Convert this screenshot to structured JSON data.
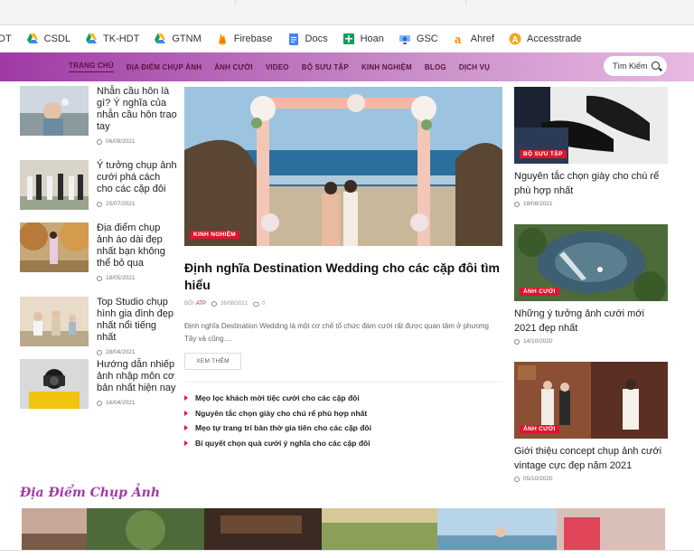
{
  "bookmarks": [
    {
      "label": "DT",
      "icon": "drive-icon"
    },
    {
      "label": "CSDL",
      "icon": "drive-icon"
    },
    {
      "label": "TK-HDT",
      "icon": "drive-icon"
    },
    {
      "label": "GTNM",
      "icon": "drive-icon"
    },
    {
      "label": "Firebase",
      "icon": "firebase-icon"
    },
    {
      "label": "Docs",
      "icon": "docs-icon"
    },
    {
      "label": "Hoan",
      "icon": "sheets-icon"
    },
    {
      "label": "GSC",
      "icon": "search-console-icon"
    },
    {
      "label": "Ahref",
      "icon": "ahrefs-icon"
    },
    {
      "label": "Accesstrade",
      "icon": "accesstrade-icon"
    }
  ],
  "nav": {
    "items": [
      "Trang chủ",
      "Địa điểm chụp ảnh",
      "Ảnh cưới",
      "Video",
      "Bộ sưu tập",
      "Kinh nghiệm",
      "Blog",
      "Dịch vụ"
    ],
    "search_placeholder": "Tìm Kiếm"
  },
  "left_posts": [
    {
      "title": "Nhẫn cầu hôn là gì? Ý nghĩa của nhẫn cầu hôn trao tay",
      "date": "06/08/2021"
    },
    {
      "title": "Ý tưởng chụp ảnh cưới phá cách cho các cặp đôi",
      "date": "25/07/2021"
    },
    {
      "title": "Địa điểm chụp ảnh áo dài đẹp nhất bạn không thể bỏ qua",
      "date": "18/05/2021"
    },
    {
      "title": "Top Studio chụp hình gia đình đẹp nhất nổi tiếng nhất",
      "date": "28/04/2021"
    },
    {
      "title": "Hướng dẫn nhiếp ảnh nhập môn cơ bản nhất hiện nay",
      "date": "16/04/2021"
    }
  ],
  "featured": {
    "badge": "Kinh nghiệm",
    "title": "Định nghĩa Destination Wedding cho các cặp đôi tìm hiểu",
    "by": "BỞI",
    "author": "ATP",
    "date": "26/08/2021",
    "comments": "0",
    "excerpt": "Định nghĩa Destination Wedding là một cơ chế tổ chức đám cưới rất được quan tâm ở phương Tây và cũng....",
    "more_label": "Xem thêm"
  },
  "related": [
    "Mẹo lọc khách mời tiệc cưới cho các cặp đôi",
    "Nguyên tắc chọn giày cho chú rể phù hợp nhất",
    "Mẹo tự trang trí bàn thờ gia tiên cho các cặp đôi",
    "Bí quyết chọn quà cưới ý nghĩa cho các cặp đôi"
  ],
  "right_posts": [
    {
      "badge": "Bộ sưu tập",
      "title": "Nguyên tắc chọn giày cho chú rể phù hợp nhất",
      "date": "18/08/2021"
    },
    {
      "badge": "Ảnh cưới",
      "title": "Những ý tưởng ảnh cưới mới 2021 đẹp nhất",
      "date": "14/10/2020"
    },
    {
      "badge": "Ảnh cưới",
      "title": "Giới thiệu concept chụp ảnh cưới vintage cực đẹp năm 2021",
      "date": "05/10/2020"
    }
  ],
  "section": {
    "title": "Địa Điểm Chụp Ảnh"
  },
  "colors": {
    "brand": "#a33aa8",
    "badge": "#e0142e",
    "nav_text": "#5b1340"
  }
}
